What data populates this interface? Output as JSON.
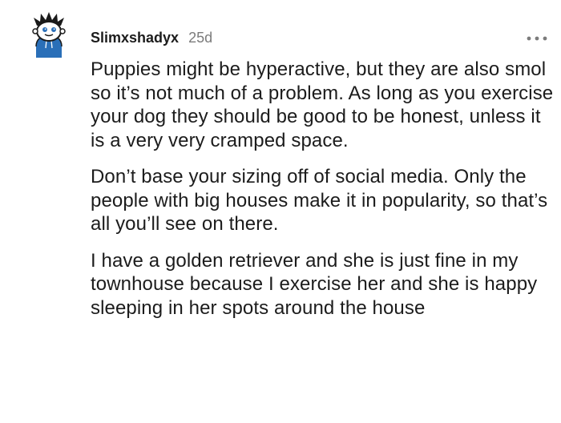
{
  "comment": {
    "author": "Slimxshadyx",
    "age": "25d",
    "more_menu_icon": "more-horizontal-icon",
    "avatar_icon": "snoo-avatar-icon",
    "paragraphs": [
      "Puppies might be hyperactive, but they are also smol so it’s not much of a problem. As long as you exercise your dog they should be good to be honest, unless it is a very very cramped space.",
      "Don’t base your sizing off of social media. Only the people with big houses make it in popularity, so that’s all you’ll see on there.",
      "I have a golden retriever and she is just fine in my townhouse because I exercise her and she is happy sleeping in her spots around the house"
    ]
  },
  "colors": {
    "text": "#1c1c1c",
    "meta": "#7c7c7c",
    "avatar_blue": "#2a6fb8",
    "avatar_bg": "#dfe3e8"
  }
}
